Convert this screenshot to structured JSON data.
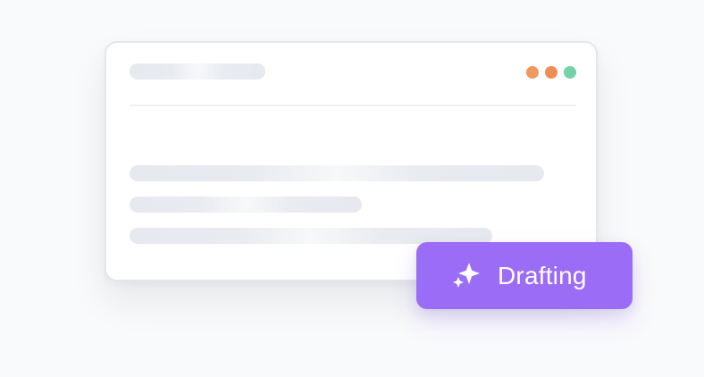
{
  "status": {
    "label": "Drafting",
    "icon": "sparkles-icon"
  },
  "window": {
    "dot_colors": [
      "#f0985d",
      "#f08d57",
      "#74d2a7"
    ]
  },
  "colors": {
    "background": "#f9fafb",
    "card": "#ffffff",
    "skeleton": "#e6e9ef",
    "accent": "#9b6cf6"
  }
}
